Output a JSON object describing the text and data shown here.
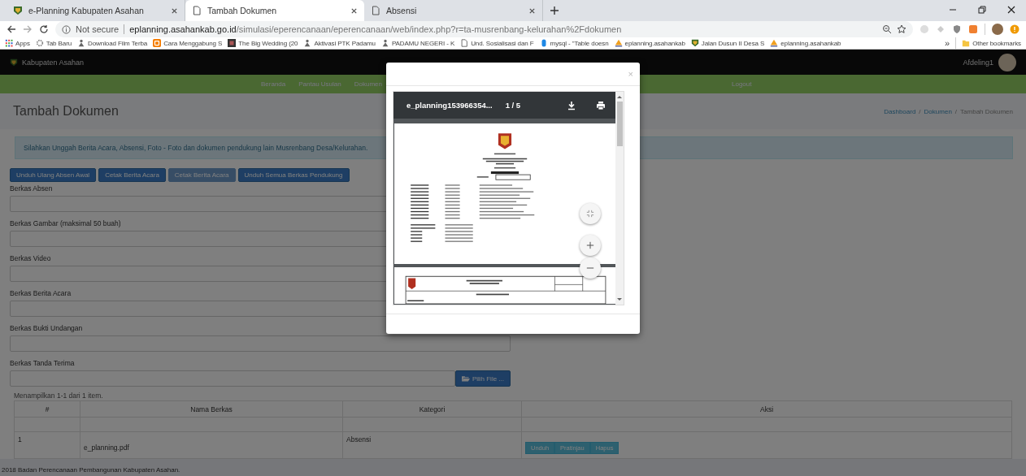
{
  "browser": {
    "tabs": [
      {
        "title": "e-Planning Kabupaten Asahan",
        "selected": false
      },
      {
        "title": "Tambah Dokumen",
        "selected": true
      },
      {
        "title": "Absensi",
        "selected": false
      }
    ],
    "security": "Not secure",
    "url_host": "eplanning.asahankab.go.id",
    "url_path": "/simulasi/eperencanaan/eperencanaan/web/index.php?r=ta-musrenbang-kelurahan%2Fdokumen",
    "bookmarks": [
      {
        "label": "Apps"
      },
      {
        "label": "Tab Baru"
      },
      {
        "label": "Download Film Terba"
      },
      {
        "label": "Cara Menggabung S"
      },
      {
        "label": "The Big Wedding (20"
      },
      {
        "label": "Aktivasi PTK Padamu"
      },
      {
        "label": "PADAMU NEGERI - K"
      },
      {
        "label": "Und. Sosialisasi dan F"
      },
      {
        "label": "mysql - \"Table doesn"
      },
      {
        "label": "eplanning.asahankab"
      },
      {
        "label": "Jalan Dusun II Desa S"
      },
      {
        "label": "eplanning.asahankab"
      }
    ],
    "more": "»",
    "other_bookmarks": "Other bookmarks"
  },
  "navbar": {
    "brand": "Kabupaten Asahan",
    "user": "Afdeling1"
  },
  "menu": [
    {
      "label": "Beranda"
    },
    {
      "label": "Pantau Usulan"
    },
    {
      "label": "Dokumen"
    }
  ],
  "menu_right": "Logout",
  "page_title": "Tambah Dokumen",
  "breadcrumb": [
    "Dashboard",
    "Dokumen",
    "Tambah Dokumen"
  ],
  "breadcrumb_separator": "/",
  "alert": "Silahkan Unggah Berita Acara, Absensi, Foto - Foto dan dokumen pendukung lain Musrenbang Desa/Kelurahan.",
  "actions": [
    {
      "label": "Unduh Ulang Absen Awal",
      "disabled": false
    },
    {
      "label": "Cetak Berita Acara",
      "disabled": false
    },
    {
      "label": "Cetak Berita Acara",
      "disabled": true
    },
    {
      "label": "Unduh Semua Berkas Pendukung",
      "disabled": false
    }
  ],
  "fields": [
    {
      "label": "Berkas Absen"
    },
    {
      "label": "Berkas Gambar (maksimal 50 buah)"
    },
    {
      "label": "Berkas Video"
    },
    {
      "label": "Berkas Berita Acara"
    },
    {
      "label": "Berkas Bukti Undangan"
    },
    {
      "label": "Berkas Tanda Terima",
      "button": "Pilih File ..."
    }
  ],
  "summary": "Menampilkan 1-1 dari 1 item.",
  "table": {
    "columns": [
      "#",
      "Nama Berkas",
      "Kategori",
      "Aksi"
    ],
    "rows": [
      {
        "no": "1",
        "name": "e_planning.pdf",
        "category": "Absensi",
        "buttons": [
          "Unduh",
          "Pratinjau",
          "Hapus"
        ]
      }
    ]
  },
  "footer": "2018 Badan Perencanaan Pembangunan Kabupaten Asahan.",
  "modal": {
    "close": "×",
    "viewer": {
      "file": "e_planning153966354...",
      "page": "1 / 5"
    }
  }
}
